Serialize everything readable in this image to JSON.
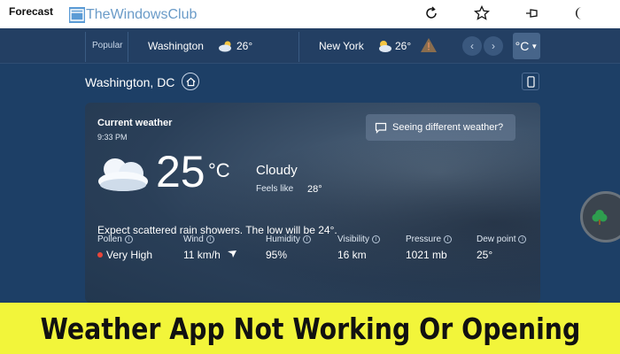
{
  "window": {
    "title": "Forecast",
    "watermark": "TheWindowsClub",
    "toolbar_icons": [
      "refresh-icon",
      "star-icon",
      "pin-icon",
      "moon-icon"
    ]
  },
  "city_bar": {
    "popular_label": "Popular",
    "cities": [
      {
        "name": "Washington",
        "temp": "26°",
        "icon": "partly-cloudy-icon"
      },
      {
        "name": "New York",
        "temp": "26°",
        "icon": "partly-sunny-icon",
        "alert_icon": "warning-icon"
      }
    ],
    "unit_label": "°C"
  },
  "location": {
    "title": "Washington, DC"
  },
  "current": {
    "title": "Current weather",
    "time": "9:33 PM",
    "feedback_button": "Seeing different weather?",
    "temperature": "25",
    "unit": "°C",
    "condition": "Cloudy",
    "feels_like_label": "Feels like",
    "feels_like_value": "28°",
    "summary": "Expect scattered rain showers. The low will be 24°.",
    "details": [
      {
        "label": "Pollen",
        "value": "Very High",
        "indicator_color": "#e8463a"
      },
      {
        "label": "Wind",
        "value": "11 km/h"
      },
      {
        "label": "Humidity",
        "value": "95%"
      },
      {
        "label": "Visibility",
        "value": "16 km"
      },
      {
        "label": "Pressure",
        "value": "1021 mb"
      },
      {
        "label": "Dew point",
        "value": "25°"
      }
    ]
  },
  "banner": {
    "text": "Weather App Not Working Or Opening",
    "background": "#f2f53a"
  },
  "colors": {
    "app_background": "#1d3f66",
    "accent_tree": "#2e9e4f"
  }
}
